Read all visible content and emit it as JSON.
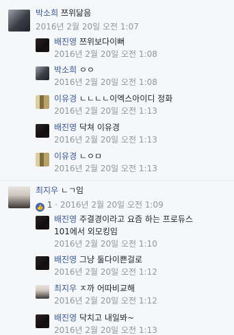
{
  "comments": [
    {
      "author": "박소희",
      "text": "쯔위닮음",
      "timestamp": "2016년 2월 20일 오전 1:07",
      "replies": [
        {
          "author": "배진영",
          "text": "쯔위보다이뻐",
          "timestamp": "2016년 2월 20일 오전 1:08"
        },
        {
          "author": "박소희",
          "text": "ㅇㅇ",
          "timestamp": "2016년 2월 20일 오전 1:08"
        },
        {
          "author": "이유경",
          "text": "ㄴㄴㄴㄴ이엑스아이디 정화",
          "timestamp": "2016년 2월 20일 오전 1:13"
        },
        {
          "author": "배진영",
          "text": "닥쳐 이유경",
          "timestamp": "2016년 2월 20일 오전 1:13"
        },
        {
          "author": "이유경",
          "text": "ㄴㅇㅁ",
          "timestamp": "2016년 2월 20일 오전 1:13"
        }
      ]
    },
    {
      "author": "최지우",
      "text": "ㄴㄱ임",
      "like_count": "1",
      "separator": "·",
      "timestamp": "2016년 2월 20일 오전 1:09",
      "replies": [
        {
          "author": "배진영",
          "text_line1": "주결경이라고 요즘 하는 프로듀스",
          "text_line2": "101에서 외모킹임",
          "timestamp": "2016년 2월 20일 오전 1:10"
        },
        {
          "author": "배진영",
          "text": "그냥 둘다이쁜걸로",
          "timestamp": "2016년 2월 20일 오전 1:12"
        },
        {
          "author": "최지우",
          "text": "ㅈ까 어따비교해",
          "timestamp": "2016년 2월 20일 오전 1:12"
        },
        {
          "author": "배진영",
          "text": "닥치고 내일봐~",
          "timestamp": "2016년 2월 20일 오전 1:13"
        }
      ]
    }
  ],
  "icons": {
    "like": "thumbs-up-icon"
  }
}
